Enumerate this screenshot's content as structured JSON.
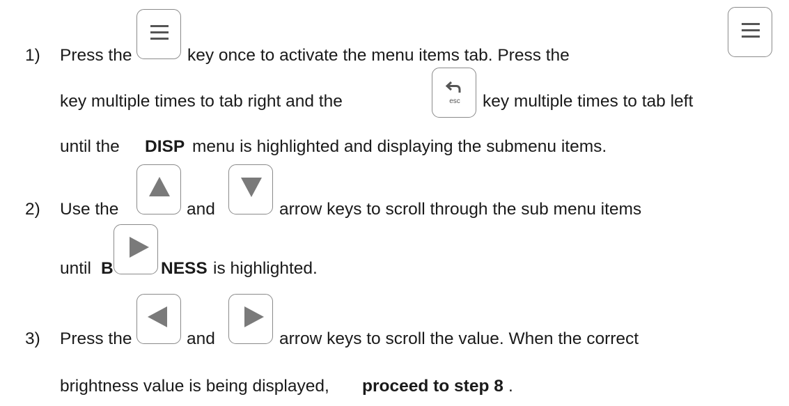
{
  "steps": [
    {
      "number": "1)",
      "line1": {
        "a": "Press the",
        "b": "key once to activate the menu items tab.  Press the"
      },
      "line2": {
        "a": "key multiple times to tab right and the",
        "b": "key multiple times to tab left"
      },
      "line3": {
        "a": "until the",
        "bold": "DISP",
        "b": "menu is highlighted and displaying the submenu items."
      }
    },
    {
      "number": "2)",
      "line1": {
        "a": "Use the",
        "b": "and",
        "c": "arrow keys to scroll through the sub menu items"
      },
      "line2": {
        "a": "until",
        "bold1": "B",
        "bold2": "NESS",
        "b": "is highlighted."
      }
    },
    {
      "number": "3)",
      "line1": {
        "a": "Press the",
        "b": "and",
        "c": "arrow keys to scroll the value.  When the correct"
      },
      "line2": {
        "a": "brightness value is being displayed,",
        "bold": "proceed to step 8",
        "end": "."
      }
    }
  ],
  "keys": {
    "menu_icon": "menu-icon",
    "esc_icon": "esc-icon",
    "esc_label": "esc",
    "up_icon": "up-arrow-icon",
    "down_icon": "down-arrow-icon",
    "left_icon": "left-arrow-icon",
    "right_icon": "right-arrow-icon",
    "icon_color": "#7a7a7a",
    "border_color": "#8a8a8a"
  }
}
